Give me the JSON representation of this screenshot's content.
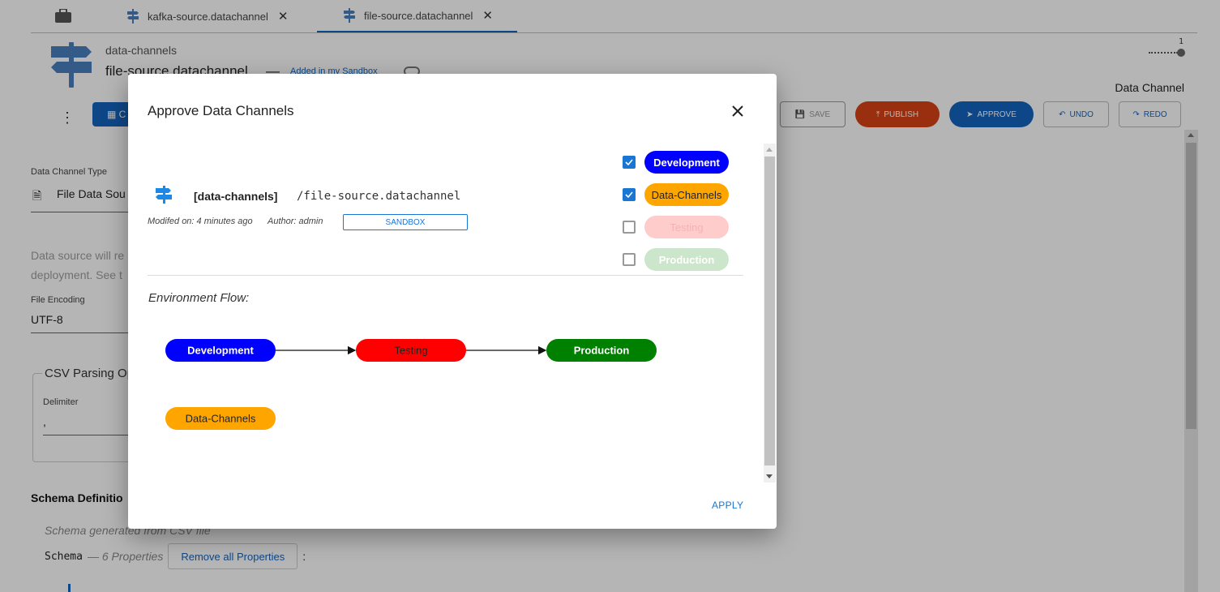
{
  "tabs": [
    {
      "label": "kafka-source.datachannel",
      "active": false
    },
    {
      "label": "file-source.datachannel",
      "active": true
    }
  ],
  "header": {
    "breadcrumb": "data-channels",
    "title": "file-source.datachannel",
    "title_dash": "—",
    "sandbox_link": "Added in my Sandbox"
  },
  "stepper": {
    "current": "1"
  },
  "right_label": "Data Channel",
  "toolbar": {
    "grid_label": "C",
    "save": "SAVE",
    "publish": "PUBLISH",
    "approve": "APPROVE",
    "undo": "UNDO",
    "redo": "REDO"
  },
  "form": {
    "type_label": "Data Channel Type",
    "type_value": "File Data Sou",
    "description": [
      "Data source will re",
      "deployment. See t"
    ],
    "encoding_label": "File Encoding",
    "encoding_value": "UTF-8",
    "csv_legend": "CSV Parsing Opt",
    "delimiter_label": "Delimiter",
    "delimiter_value": ",",
    "schema_title": "Schema Definitio",
    "schema_note": "Schema generated from CSV file",
    "schema_label": "Schema",
    "schema_props": "— 6 Properties",
    "remove_all": "Remove all Properties",
    "colon": ":"
  },
  "modal": {
    "title": "Approve Data Channels",
    "item": {
      "namespace": "[data-channels]",
      "path": "/file-source.datachannel",
      "modified": "Modifed on: 4 minutes ago",
      "author": "Author: admin",
      "badge": "SANDBOX"
    },
    "environments": [
      {
        "label": "Development",
        "checked": true,
        "bg": "#0000ff",
        "fg": "#ffffff"
      },
      {
        "label": "Data-Channels",
        "checked": true,
        "bg": "#ffa500",
        "fg": "#222222"
      },
      {
        "label": "Testing",
        "checked": false,
        "bg": "#ffcccc",
        "fg": "#f3b3b3"
      },
      {
        "label": "Production",
        "checked": false,
        "bg": "#cce6cc",
        "fg": "#ffffff"
      }
    ],
    "flow_label": "Environment Flow:",
    "flow_nodes": [
      {
        "label": "Development",
        "bg": "#0000ff",
        "fg": "#ffffff"
      },
      {
        "label": "Testing",
        "bg": "#ff0000",
        "fg": "#222222"
      },
      {
        "label": "Production",
        "bg": "#008000",
        "fg": "#ffffff"
      },
      {
        "label": "Data-Channels",
        "bg": "#ffa500",
        "fg": "#222222"
      }
    ],
    "flow_edges": [
      [
        "Development",
        "Testing"
      ],
      [
        "Testing",
        "Production"
      ]
    ],
    "apply": "APPLY"
  }
}
